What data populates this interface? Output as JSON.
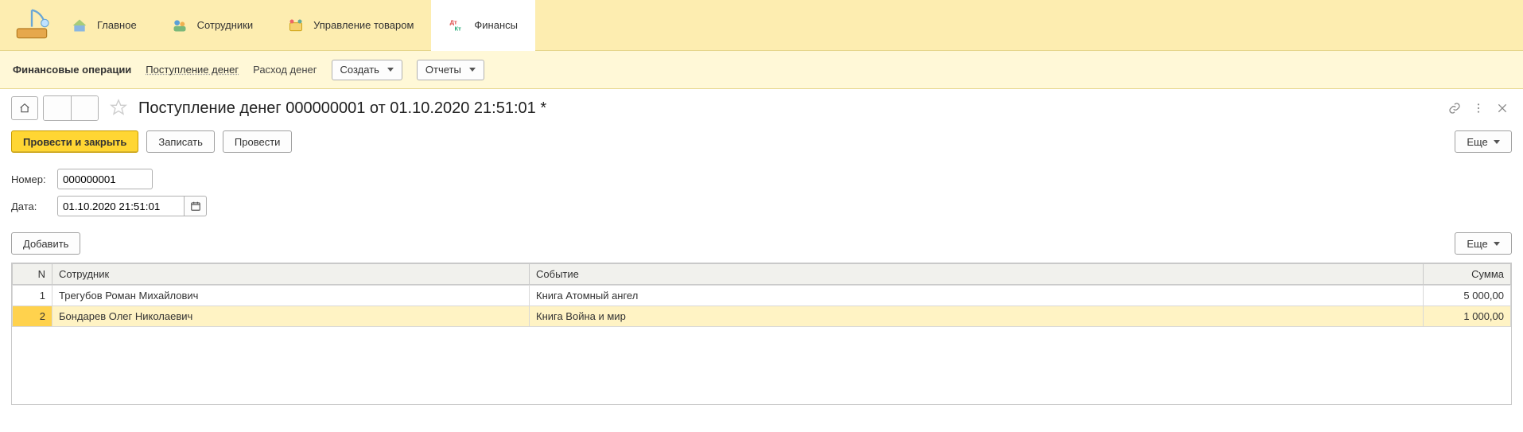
{
  "topnav": {
    "items": [
      {
        "label": "Главное"
      },
      {
        "label": "Сотрудники"
      },
      {
        "label": "Управление товаром"
      },
      {
        "label": "Финансы"
      }
    ]
  },
  "subnav": {
    "title": "Финансовые операции",
    "link": "Поступление денег",
    "plain": "Расход денег",
    "create": "Создать",
    "reports": "Отчеты"
  },
  "doc": {
    "title": "Поступление денег 000000001 от 01.10.2020 21:51:01 *"
  },
  "actions": {
    "post_close": "Провести и закрыть",
    "write": "Записать",
    "post": "Провести",
    "more": "Еще"
  },
  "fields": {
    "number_label": "Номер:",
    "number_value": "000000001",
    "date_label": "Дата:",
    "date_value": "01.10.2020 21:51:01"
  },
  "tbltools": {
    "add": "Добавить",
    "more": "Еще"
  },
  "table": {
    "headers": {
      "n": "N",
      "emp": "Сотрудник",
      "evt": "Событие",
      "sum": "Сумма"
    },
    "rows": [
      {
        "n": "1",
        "emp": "Трегубов Роман Михайлович",
        "evt": "Книга Атомный ангел",
        "sum": "5 000,00",
        "selected": false
      },
      {
        "n": "2",
        "emp": "Бондарев Олег Николаевич",
        "evt": "Книга Война и мир",
        "sum": "1 000,00",
        "selected": true
      }
    ]
  }
}
